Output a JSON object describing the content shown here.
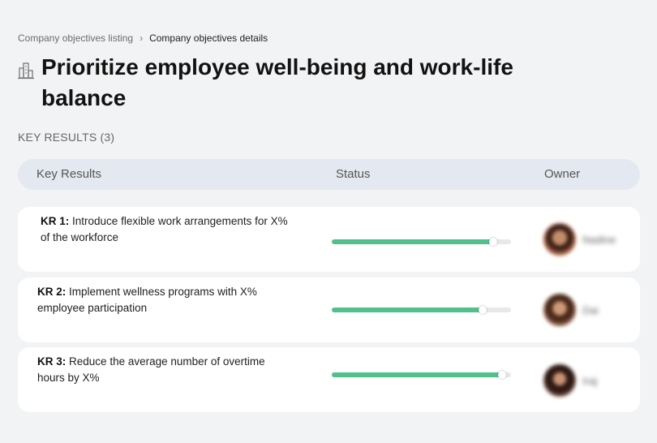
{
  "breadcrumb": {
    "parent": "Company objectives listing",
    "separator": "›",
    "current": "Company objectives details"
  },
  "objective": {
    "title": "Prioritize employee well-being and work-life balance",
    "icon": "building-icon"
  },
  "key_results_section": {
    "label": "KEY RESULTS (3)"
  },
  "table": {
    "columns": [
      "Key Results",
      "Status",
      "Owner"
    ]
  },
  "key_results": [
    {
      "id": "KR 1:",
      "text": "Introduce flexible work arrangements for X% of the workforce",
      "progress": 0.9,
      "owner": "Nadine"
    },
    {
      "id": "KR 2:",
      "text": "Implement wellness programs with X% employee participation",
      "progress": 0.84,
      "owner": "Dai"
    },
    {
      "id": "KR 3:",
      "text": "Reduce the average number of overtime hours by X%",
      "progress": 0.95,
      "owner": "Iraj"
    }
  ],
  "colors": {
    "progress_fill": "#52c08b",
    "progress_track": "#e8e8e8",
    "header_bg": "#e4e9f1",
    "page_bg": "#f2f3f5"
  }
}
